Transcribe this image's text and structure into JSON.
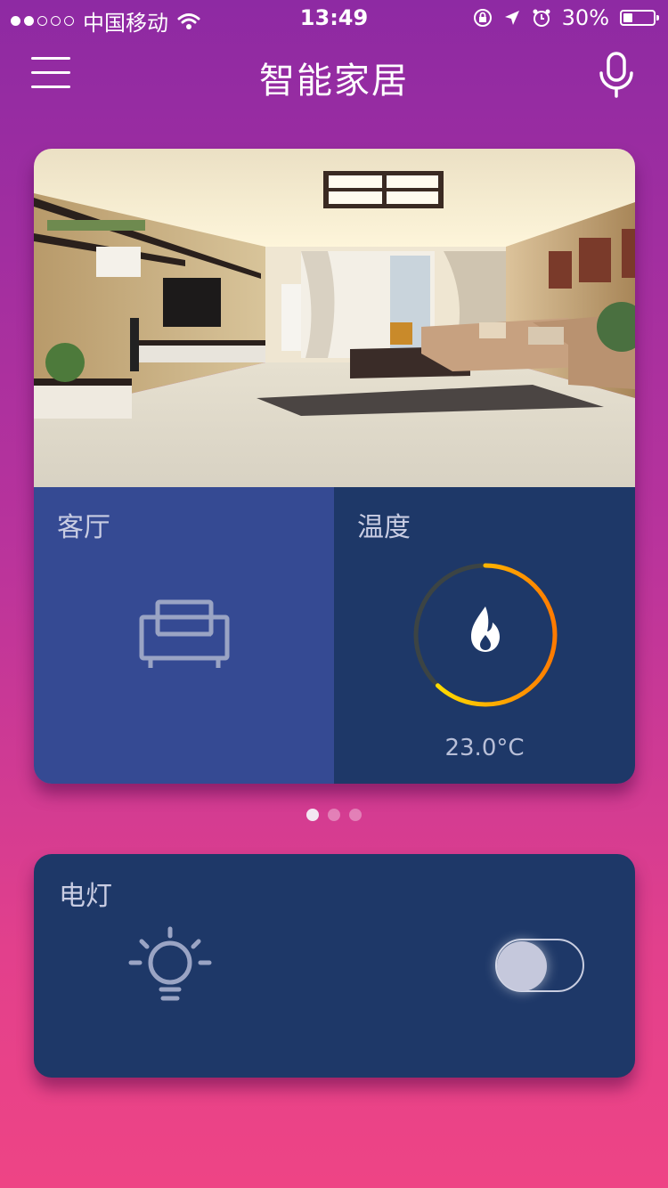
{
  "status_bar": {
    "signal_dots": [
      "on",
      "on",
      "off",
      "off",
      "off"
    ],
    "carrier": "中国移动",
    "time": "13:49",
    "battery": "30%",
    "battery_level": 0.3,
    "icons": [
      "wifi-icon",
      "orientation-lock-icon",
      "location-arrow-icon",
      "alarm-icon",
      "battery-icon"
    ]
  },
  "header": {
    "title": "智能家居",
    "left_icon": "menu-icon",
    "right_icon": "microphone-icon"
  },
  "room_card": {
    "image": "living-room-photo",
    "room_tile": {
      "label": "客厅",
      "icon": "sofa-icon"
    },
    "temperature_tile": {
      "label": "温度",
      "icon": "flame-icon",
      "value": "23.0°C",
      "gauge_level": 0.62
    }
  },
  "pager": {
    "count": 3,
    "active_index": 0
  },
  "light_card": {
    "label": "电灯",
    "icon": "light-bulb-icon",
    "switch_on": false
  },
  "colors": {
    "room_tile": "#354a93",
    "temp_tile": "#1e3868",
    "gauge_start": "#ffee00",
    "gauge_end": "#ff7a00",
    "background_top": "#8e2aa3",
    "background_bottom": "#ee4485"
  }
}
